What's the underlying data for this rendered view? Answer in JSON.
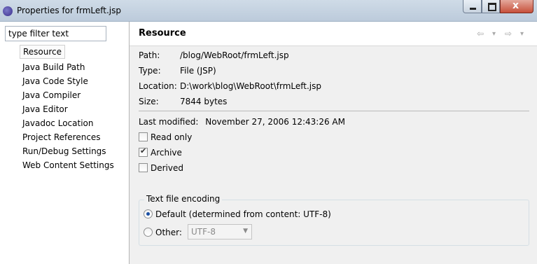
{
  "window": {
    "title": "Properties for frmLeft.jsp",
    "close_glyph": "x"
  },
  "filter": {
    "value": "type filter text",
    "placeholder": "type filter text"
  },
  "tree": {
    "items": [
      "Resource",
      "Java Build Path",
      "Java Code Style",
      "Java Compiler",
      "Java Editor",
      "Javadoc Location",
      "Project References",
      "Run/Debug Settings",
      "Web Content Settings"
    ],
    "selected": "Resource"
  },
  "page": {
    "title": "Resource",
    "nav": {
      "back_glyph": "⇦",
      "forward_glyph": "⇨",
      "menu_glyph": "▾"
    },
    "path_label": "Path:",
    "path_value": "/blog/WebRoot/frmLeft.jsp",
    "type_label": "Type:",
    "type_value": "File  (JSP)",
    "location_label": "Location:",
    "location_value": "D:\\work\\blog\\WebRoot\\frmLeft.jsp",
    "size_label": "Size:",
    "size_value": "7844  bytes",
    "modified_label": "Last modified:",
    "modified_value": "November 27, 2006 12:43:26 AM",
    "attributes": [
      {
        "label": "Read only",
        "checked": false
      },
      {
        "label": "Archive",
        "checked": true
      },
      {
        "label": "Derived",
        "checked": false
      }
    ],
    "encoding": {
      "group_label": "Text file encoding",
      "default_label": "Default (determined from content: UTF-8)",
      "default_selected": true,
      "other_label": "Other:",
      "other_value": "UTF-8",
      "combo_arrow": "▼"
    }
  }
}
